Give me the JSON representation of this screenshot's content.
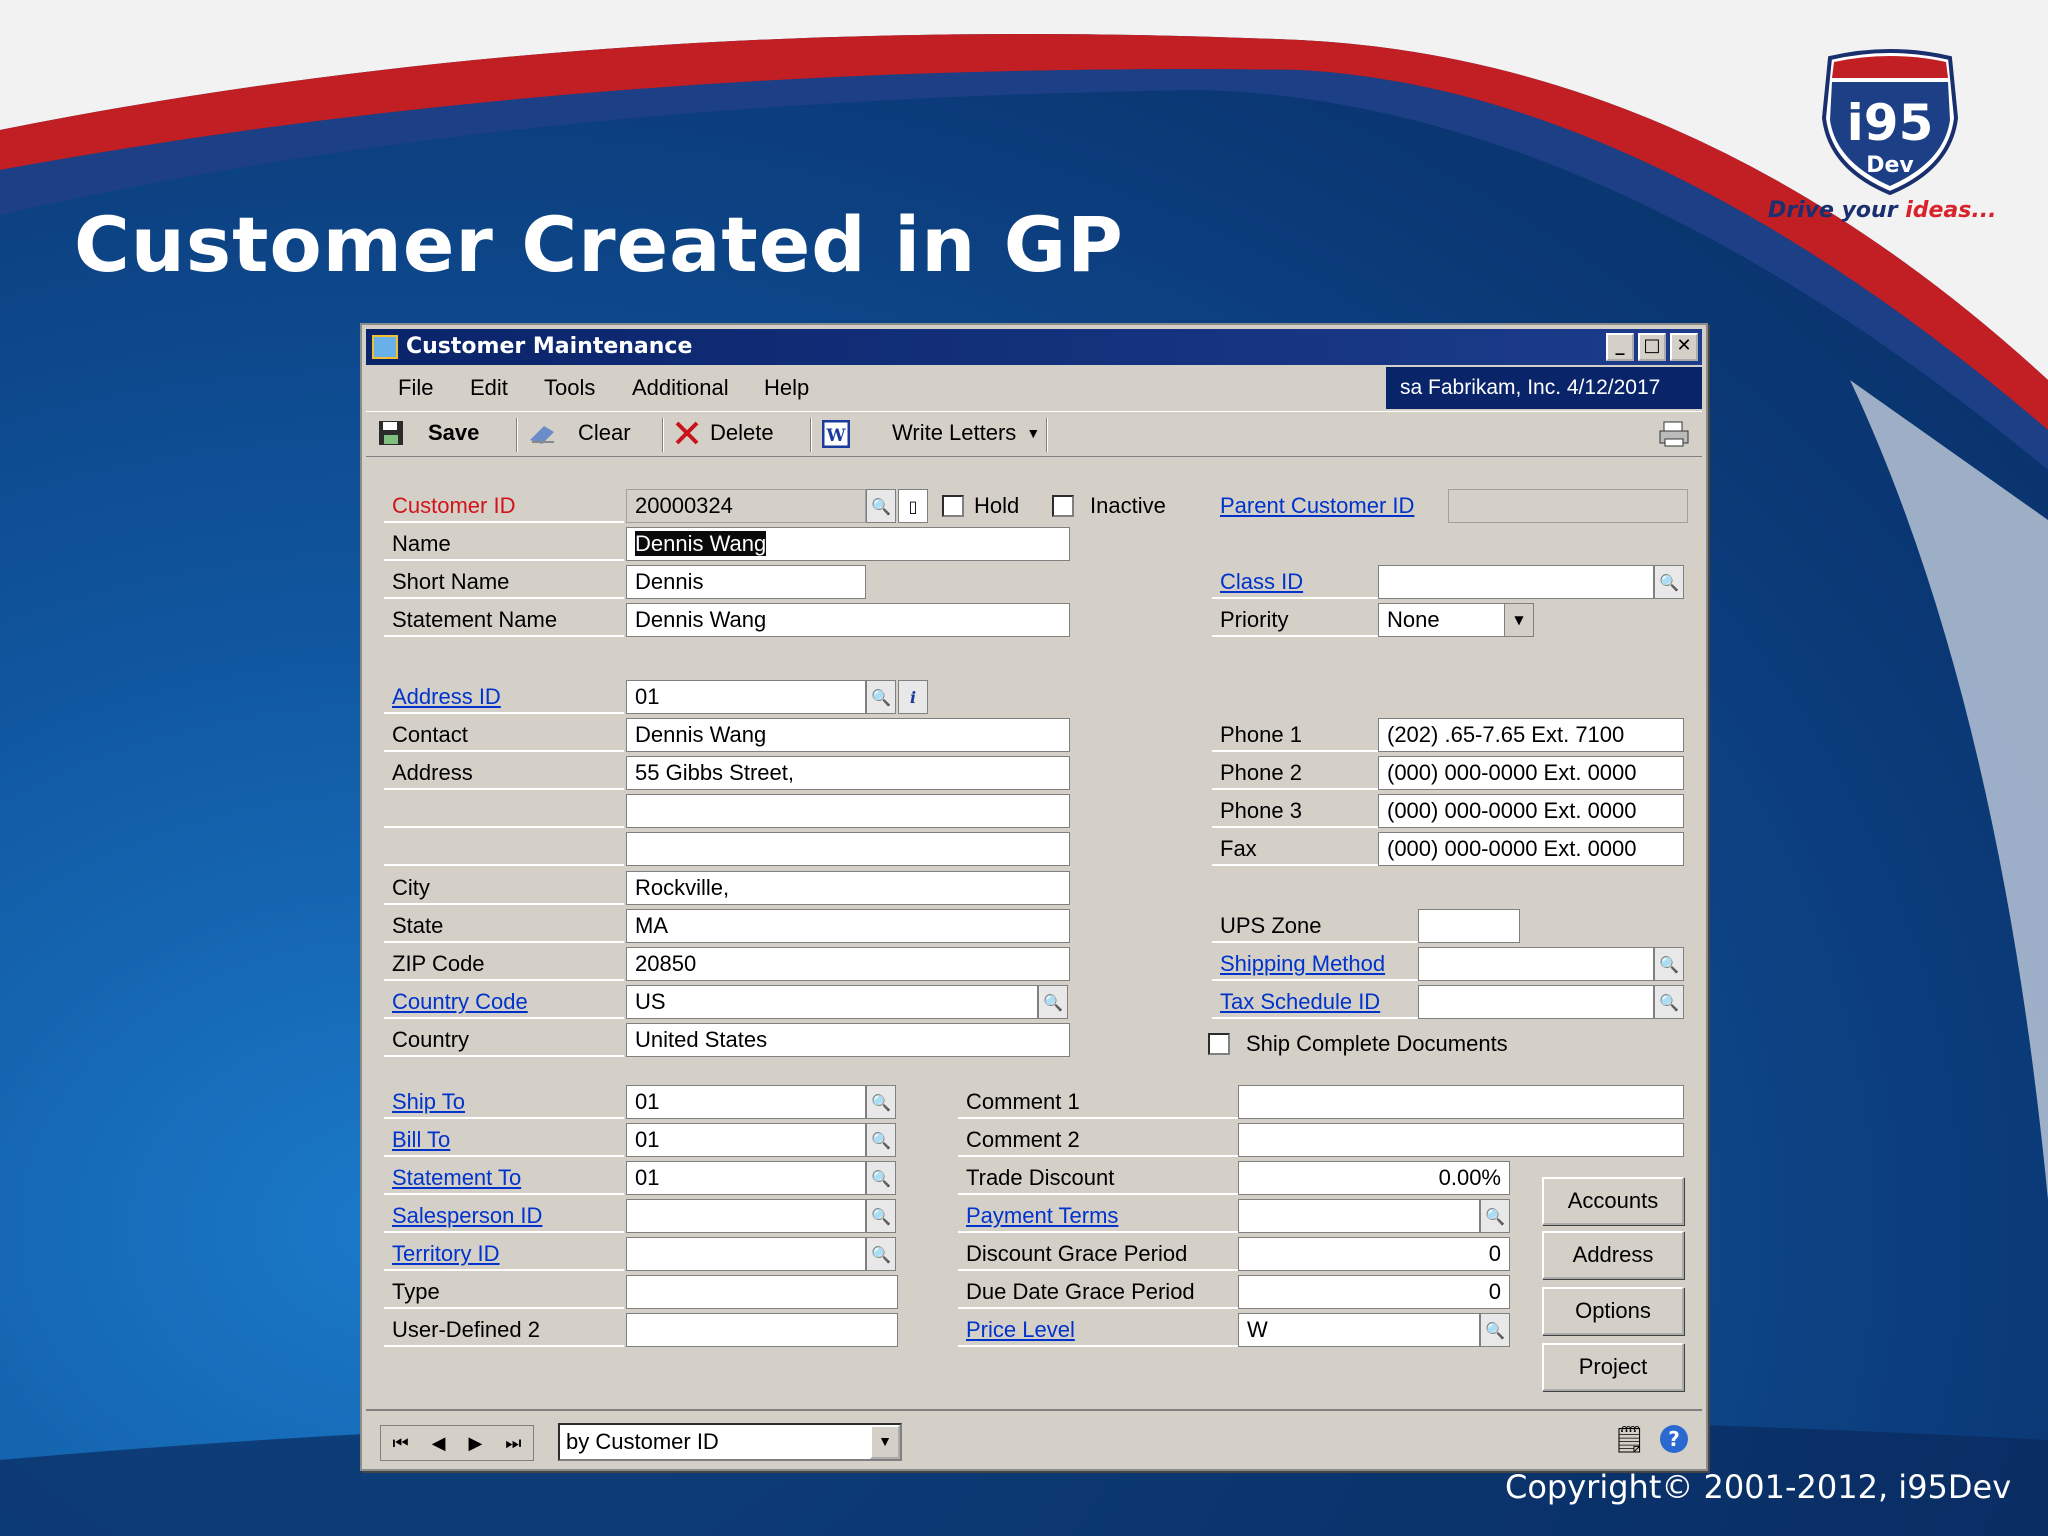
{
  "slide": {
    "title": "Customer Created in GP",
    "logo_text": "i95",
    "logo_sub": "Dev",
    "tagline_a": "Drive your ",
    "tagline_b": "ideas...",
    "copyright": "Copyright© 2001-2012, i95Dev"
  },
  "window": {
    "title": "Customer Maintenance",
    "menus": [
      "File",
      "Edit",
      "Tools",
      "Additional",
      "Help"
    ],
    "user_info": "sa  Fabrikam, Inc.  4/12/2017",
    "toolbar": {
      "save": "Save",
      "clear": "Clear",
      "delete": "Delete",
      "write_letters": "Write Letters"
    }
  },
  "form": {
    "customer_id": {
      "label": "Customer ID",
      "value": "20000324"
    },
    "hold": "Hold",
    "inactive": "Inactive",
    "parent_customer_id": {
      "label": "Parent Customer ID",
      "value": ""
    },
    "name": {
      "label": "Name",
      "value": "Dennis Wang"
    },
    "short_name": {
      "label": "Short Name",
      "value": "Dennis"
    },
    "statement_name": {
      "label": "Statement Name",
      "value": "Dennis Wang"
    },
    "class_id": {
      "label": "Class ID",
      "value": ""
    },
    "priority": {
      "label": "Priority",
      "value": "None"
    },
    "address_id": {
      "label": "Address ID",
      "value": "01"
    },
    "contact": {
      "label": "Contact",
      "value": "Dennis Wang"
    },
    "address": {
      "label": "Address",
      "line1": "55 Gibbs Street,",
      "line2": "",
      "line3": ""
    },
    "city": {
      "label": "City",
      "value": "Rockville,"
    },
    "state": {
      "label": "State",
      "value": "MA"
    },
    "zip": {
      "label": "ZIP Code",
      "value": "20850"
    },
    "country_code": {
      "label": "Country Code",
      "value": "US"
    },
    "country": {
      "label": "Country",
      "value": "United States"
    },
    "phone1": {
      "label": "Phone 1",
      "value": "(202) .65-7.65  Ext. 7100"
    },
    "phone2": {
      "label": "Phone 2",
      "value": "(000) 000-0000  Ext. 0000"
    },
    "phone3": {
      "label": "Phone 3",
      "value": "(000) 000-0000  Ext. 0000"
    },
    "fax": {
      "label": "Fax",
      "value": "(000) 000-0000  Ext. 0000"
    },
    "ups_zone": {
      "label": "UPS Zone",
      "value": ""
    },
    "shipping_method": {
      "label": "Shipping Method",
      "value": ""
    },
    "tax_schedule_id": {
      "label": "Tax Schedule ID",
      "value": ""
    },
    "ship_complete": "Ship Complete Documents",
    "ship_to": {
      "label": "Ship To",
      "value": "01"
    },
    "bill_to": {
      "label": "Bill To",
      "value": "01"
    },
    "statement_to": {
      "label": "Statement To",
      "value": "01"
    },
    "salesperson_id": {
      "label": "Salesperson ID",
      "value": ""
    },
    "territory_id": {
      "label": "Territory ID",
      "value": ""
    },
    "type": {
      "label": "Type",
      "value": ""
    },
    "user_defined2": {
      "label": "User-Defined 2",
      "value": ""
    },
    "comment1": {
      "label": "Comment 1",
      "value": ""
    },
    "comment2": {
      "label": "Comment 2",
      "value": ""
    },
    "trade_discount": {
      "label": "Trade Discount",
      "value": "0.00%"
    },
    "payment_terms": {
      "label": "Payment Terms",
      "value": ""
    },
    "discount_grace": {
      "label": "Discount Grace Period",
      "value": "0"
    },
    "due_date_grace": {
      "label": "Due Date Grace Period",
      "value": "0"
    },
    "price_level": {
      "label": "Price Level",
      "value": "W"
    }
  },
  "buttons": {
    "accounts": "Accounts",
    "address": "Address",
    "options": "Options",
    "project": "Project"
  },
  "status": {
    "sort_by": "by Customer ID"
  }
}
